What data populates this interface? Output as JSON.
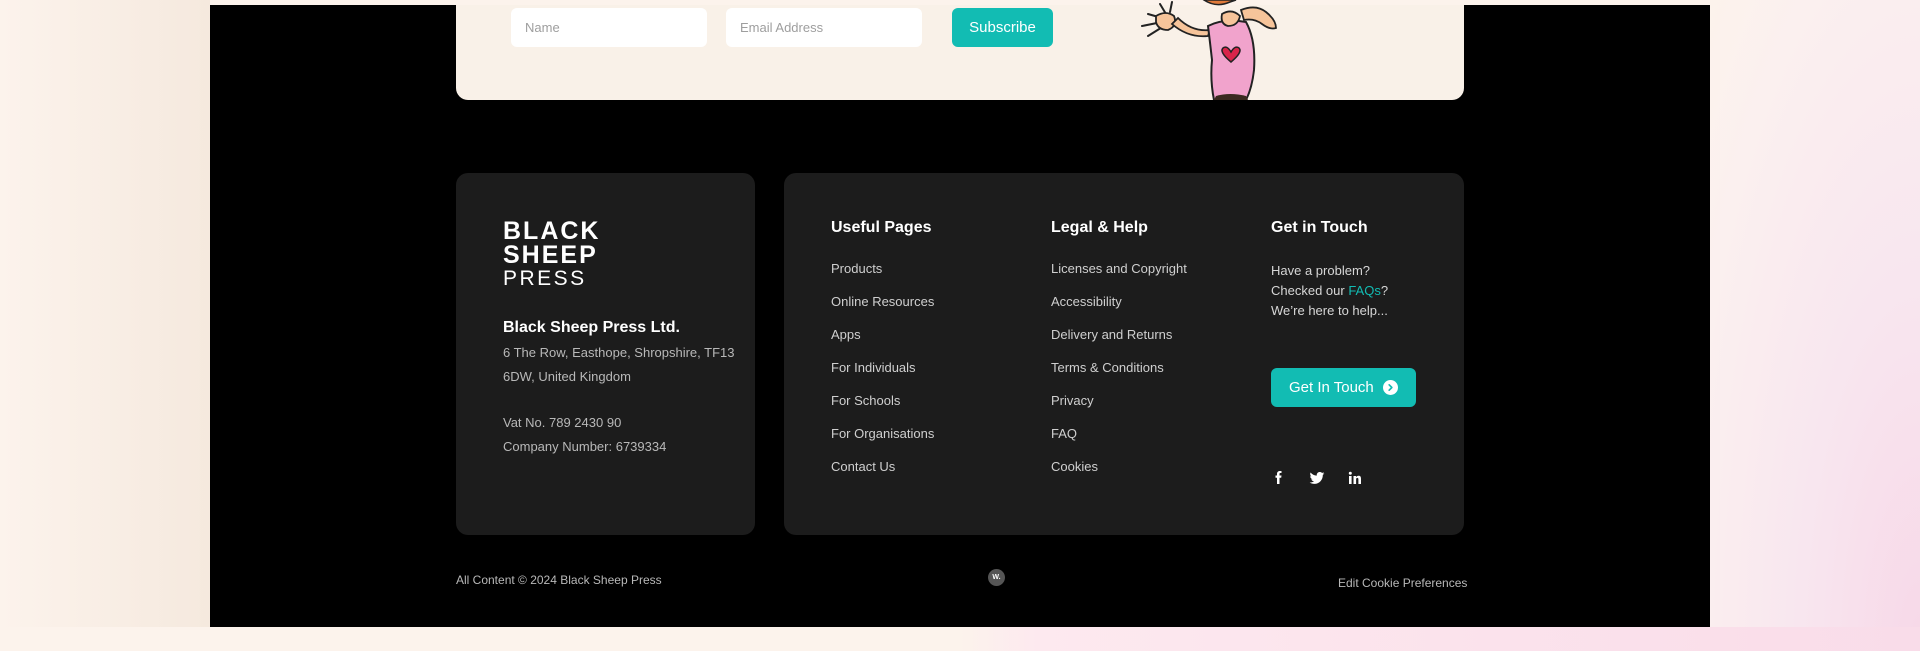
{
  "newsletter": {
    "name_placeholder": "Name",
    "email_placeholder": "Email Address",
    "subscribe_label": "Subscribe"
  },
  "company": {
    "logo_lines": [
      "BLACK",
      "SHEEP",
      "PRESS"
    ],
    "name": "Black Sheep Press Ltd.",
    "address_line1": "6 The Row, Easthope, Shropshire, TF13",
    "address_line2": "6DW, United Kingdom",
    "vat": "Vat No. 789 2430 90",
    "company_number": "Company Number: 6739334"
  },
  "useful_pages": {
    "heading": "Useful Pages",
    "links": [
      "Products",
      "Online Resources",
      "Apps",
      "For Individuals",
      "For Schools",
      "For Organisations",
      "Contact Us"
    ]
  },
  "legal_help": {
    "heading": "Legal & Help",
    "links": [
      "Licenses and Copyright",
      "Accessibility",
      "Delivery and Returns",
      "Terms & Conditions",
      "Privacy",
      "FAQ",
      "Cookies"
    ]
  },
  "get_in_touch": {
    "heading": "Get in Touch",
    "line1": "Have a problem?",
    "line2_prefix": "Checked our ",
    "line2_link": "FAQs",
    "line2_suffix": "?",
    "line3": "We’re here to help...",
    "button_label": "Get In Touch",
    "social_icons": [
      "facebook-icon",
      "twitter-icon",
      "linkedin-icon"
    ]
  },
  "bottom": {
    "copyright": "All Content © 2024 Black Sheep Press",
    "badge": "W.",
    "cookie_prefs": "Edit Cookie Preferences"
  },
  "colors": {
    "accent": "#12bcb3",
    "page_bg": "#000000",
    "card_bg": "#1c1c1c",
    "newsletter_bg": "#f9f1e8"
  }
}
